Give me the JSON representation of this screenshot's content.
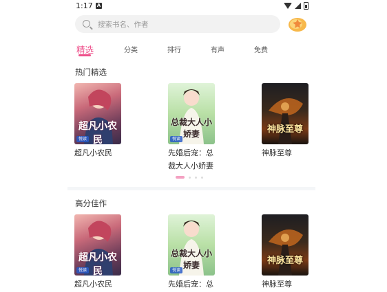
{
  "status": {
    "time": "1:17"
  },
  "search": {
    "placeholder": "搜索书名、作者"
  },
  "tabs": [
    {
      "label": "精选",
      "active": true
    },
    {
      "label": "分类"
    },
    {
      "label": "排行"
    },
    {
      "label": "有声"
    },
    {
      "label": "免费"
    }
  ],
  "sections": [
    {
      "title": "热门精选",
      "books": [
        {
          "name": "超凡小农民",
          "cover_text": "超凡小农民"
        },
        {
          "name": "先婚后宠：总裁大人小娇妻",
          "cover_text": "总裁大人小娇妻"
        },
        {
          "name": "神脉至尊",
          "cover_text": "神脉至尊"
        }
      ]
    },
    {
      "title": "高分佳作",
      "books": [
        {
          "name": "超凡小农民",
          "cover_text": "超凡小农民"
        },
        {
          "name": "先婚后宠：总",
          "cover_text": "总裁大人小娇妻"
        },
        {
          "name": "神脉至尊",
          "cover_text": "神脉至尊"
        }
      ]
    }
  ],
  "carousel": {
    "page": 1,
    "pages": 4
  },
  "colors": {
    "accent": "#ee4f8a"
  }
}
